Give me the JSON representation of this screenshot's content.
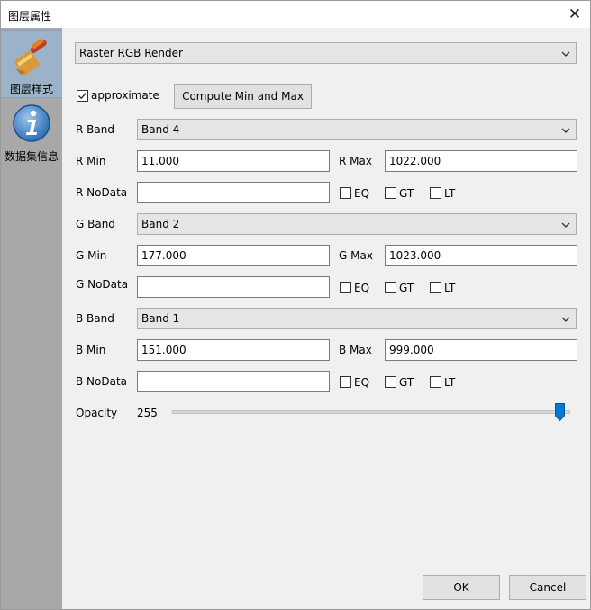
{
  "window": {
    "title": "图层属性"
  },
  "sidebar": {
    "items": [
      {
        "label": "图层样式",
        "icon": "paint-brush-icon",
        "active": true
      },
      {
        "label": "数据集信息",
        "icon": "info-icon",
        "active": false
      }
    ]
  },
  "render": {
    "type": "Raster RGB Render"
  },
  "approximate": {
    "label": "approximate",
    "checked": true
  },
  "compute_button": "Compute Min and Max",
  "bands": [
    {
      "band_label": "R Band",
      "band_value": "Band 4",
      "min_label": "R Min",
      "min_value": "11.000",
      "max_label": "R Max",
      "max_value": "1022.000",
      "nodata_label": "R NoData",
      "nodata_value": ""
    },
    {
      "band_label": "G Band",
      "band_value": "Band 2",
      "min_label": "G Min",
      "min_value": "177.000",
      "max_label": "G Max",
      "max_value": "1023.000",
      "nodata_label": "G NoData",
      "nodata_value": ""
    },
    {
      "band_label": "B Band",
      "band_value": "Band 1",
      "min_label": "B Min",
      "min_value": "151.000",
      "max_label": "B Max",
      "max_value": "999.000",
      "nodata_label": "B NoData",
      "nodata_value": ""
    }
  ],
  "nodata_options": [
    "EQ",
    "GT",
    "LT"
  ],
  "opacity": {
    "label": "Opacity",
    "value": "255",
    "fraction": 1.0
  },
  "buttons": {
    "ok": "OK",
    "cancel": "Cancel"
  },
  "colors": {
    "accent": "#0078d7",
    "sidebar": "#a8a8a8",
    "sidebar_active": "#9cb2c8"
  }
}
